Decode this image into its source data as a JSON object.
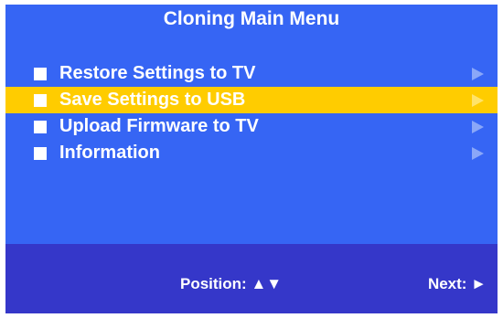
{
  "title": "Cloning Main Menu",
  "menu": {
    "items": [
      {
        "label": "Restore Settings to TV",
        "bullet": "■",
        "arrow_icon": "right-triangle-icon",
        "selected": false
      },
      {
        "label": "Save Settings to USB",
        "bullet": "■",
        "arrow_icon": "right-triangle-icon",
        "selected": true
      },
      {
        "label": "Upload Firmware to TV",
        "bullet": "■",
        "arrow_icon": "right-triangle-icon",
        "selected": false
      },
      {
        "label": "Information",
        "bullet": "■",
        "arrow_icon": "right-triangle-icon",
        "selected": false
      }
    ]
  },
  "footer": {
    "position_hint": "Position: ▲▼",
    "next_hint": "Next: ►"
  },
  "colors": {
    "background": "#3665f4",
    "selection": "#ffcc00",
    "footer": "#3537c9",
    "text": "#ffffff",
    "arrow": "#8aa7f8"
  }
}
